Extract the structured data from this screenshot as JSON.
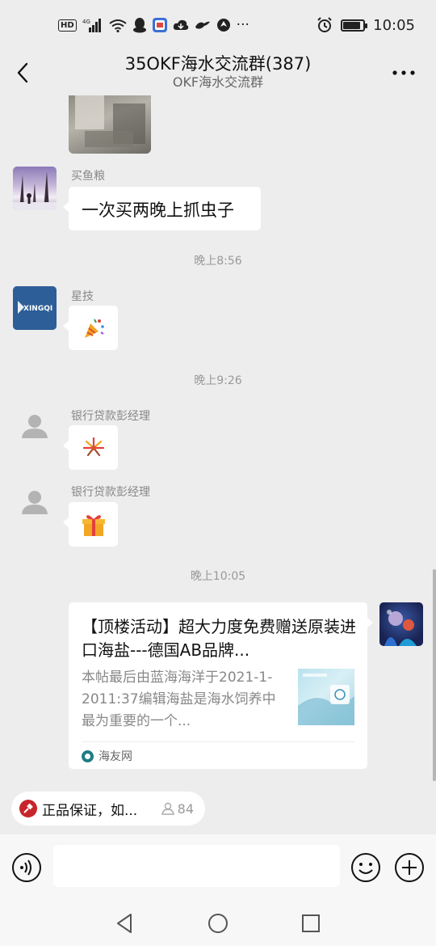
{
  "status_bar": {
    "hd": "HD",
    "network": "4G",
    "more": "···",
    "time": "10:05",
    "battery_level": 0.85
  },
  "header": {
    "title": "35OKF海水交流群(387)",
    "subtitle": "OKF海水交流群"
  },
  "messages": [
    {
      "sender": "买鱼粮",
      "text": "一次买两晚上抓虫子",
      "avatar": "winter-forest-avatar"
    },
    {
      "timestamp": "晚上8:56"
    },
    {
      "sender": "星技",
      "avatar": "xingqi-logo-avatar",
      "avatar_text": "XINGQI",
      "emoji": "party-popper-icon"
    },
    {
      "timestamp": "晚上9:26"
    },
    {
      "sender": "银行贷款彭经理",
      "avatar": "default-person-avatar",
      "emoji": "firework-icon"
    },
    {
      "sender": "银行贷款彭经理",
      "avatar": "default-person-avatar",
      "emoji": "gift-box-icon"
    },
    {
      "timestamp": "晚上10:05"
    },
    {
      "type": "link-card",
      "title": "【顶楼活动】超大力度免费赠送原装进口海盐---德国AB品牌...",
      "description": "本帖最后由蓝海海洋于2021-1-2011:37编辑海盐是海水饲养中最为重要的一个...",
      "source": "海友网",
      "avatar": "aquarium-avatar"
    }
  ],
  "notice": {
    "text": "正品保证，如...",
    "count": "84"
  },
  "input": {
    "value": "",
    "placeholder": ""
  },
  "colors": {
    "background": "#ededed",
    "bubble": "#ffffff",
    "notice_icon": "#c7252b",
    "source_icon": "#1e7c86"
  }
}
